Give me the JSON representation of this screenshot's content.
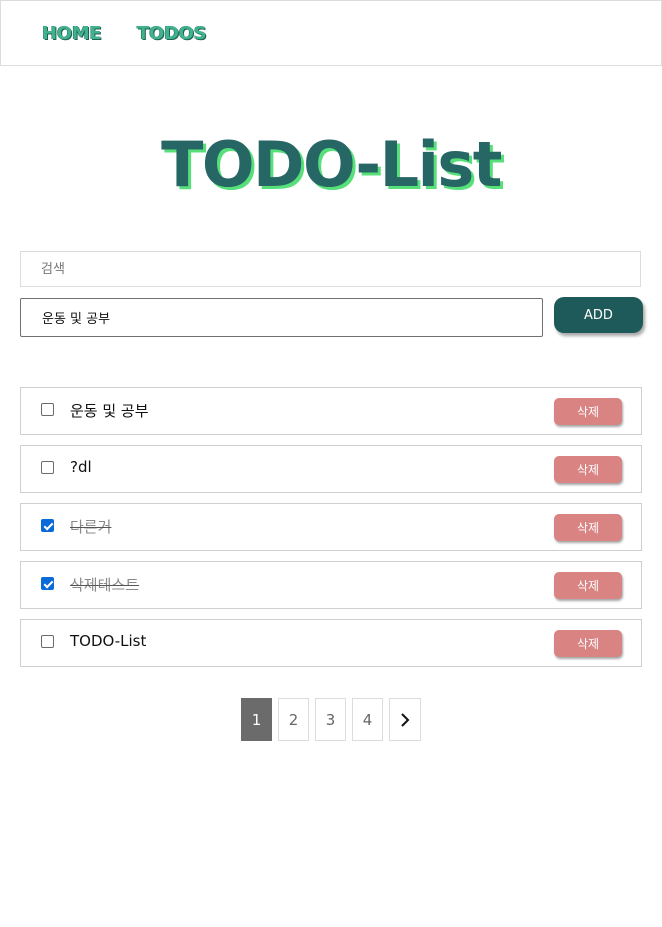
{
  "nav": {
    "home_label": "HOME",
    "todos_label": "TODOS"
  },
  "page_title": "TODO-List",
  "search": {
    "placeholder": "검색",
    "value": ""
  },
  "add_form": {
    "input_value": "운동 및 공부",
    "button_label": "ADD"
  },
  "todos": [
    {
      "text": "운동 및 공부",
      "done": false,
      "delete_label": "삭제"
    },
    {
      "text": "?dl",
      "done": false,
      "delete_label": "삭제"
    },
    {
      "text": "다른거",
      "done": true,
      "delete_label": "삭제"
    },
    {
      "text": "삭제테스트",
      "done": true,
      "delete_label": "삭제"
    },
    {
      "text": "TODO-List",
      "done": false,
      "delete_label": "삭제"
    }
  ],
  "pagination": {
    "pages": [
      "1",
      "2",
      "3",
      "4"
    ],
    "current": "1",
    "next_icon": "chevron-right-icon"
  },
  "colors": {
    "accent_dark": "#1f5a5a",
    "accent_green": "#3fb38c",
    "delete": "#d98383",
    "checkbox": "#0a6ad8"
  }
}
